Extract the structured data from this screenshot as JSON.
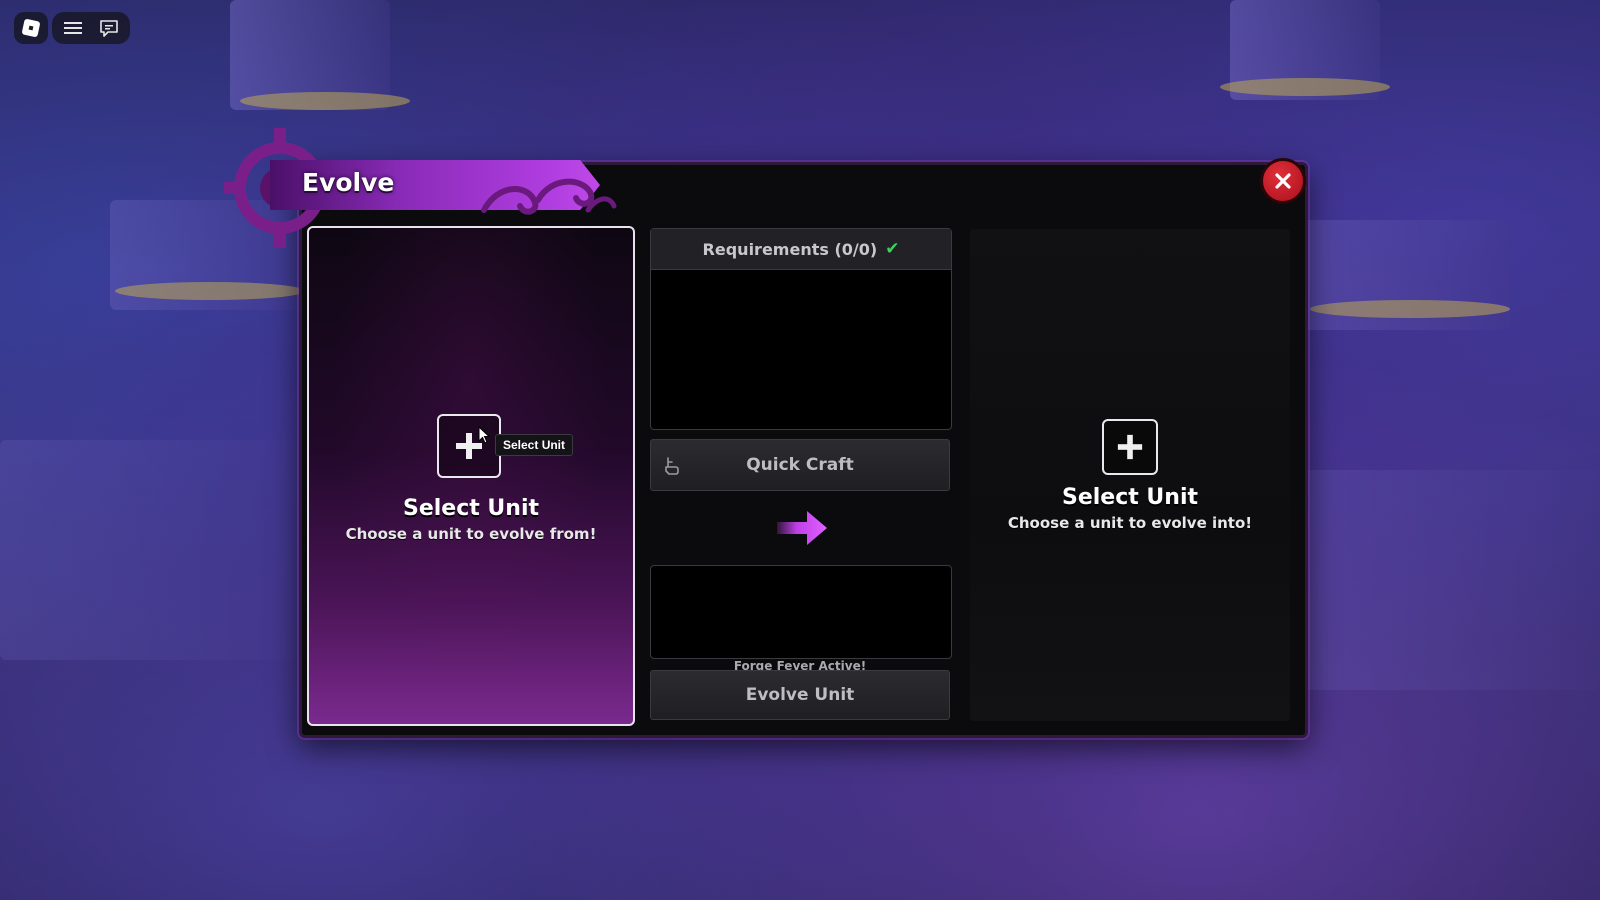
{
  "toolbar": {
    "icons": [
      "roblox-logo-icon",
      "menu-icon",
      "chat-icon"
    ]
  },
  "window": {
    "title": "Evolve",
    "accent_color": "#a83ad8",
    "close_icon": "close-icon"
  },
  "left_slot": {
    "title": "Select Unit",
    "subtitle": "Choose a unit to evolve from!",
    "tooltip": "Select Unit"
  },
  "requirements": {
    "label": "Requirements (0/0)",
    "status_icon": "checkmark-icon"
  },
  "quick_craft": {
    "label": "Quick Craft",
    "icon": "hand-icon"
  },
  "evolve": {
    "notice": "Forge Fever Active!",
    "label": "Evolve Unit"
  },
  "right_slot": {
    "title": "Select Unit",
    "subtitle": "Choose a unit to evolve into!"
  }
}
